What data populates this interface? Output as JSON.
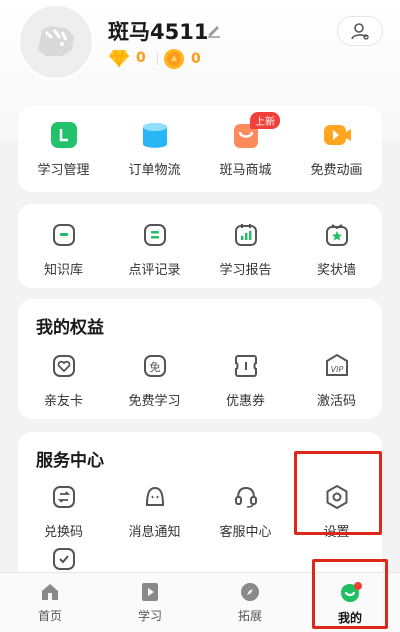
{
  "profile": {
    "username": "斑马4511",
    "gems": "0",
    "coins": "0"
  },
  "quick_actions": [
    {
      "label": "学习管理",
      "icon": "study-manage-icon"
    },
    {
      "label": "订单物流",
      "icon": "order-logistics-icon"
    },
    {
      "label": "斑马商城",
      "icon": "mall-icon",
      "badge": "上新"
    },
    {
      "label": "免费动画",
      "icon": "free-animation-icon"
    }
  ],
  "tools": [
    {
      "label": "知识库",
      "icon": "knowledge-base-icon"
    },
    {
      "label": "点评记录",
      "icon": "review-record-icon"
    },
    {
      "label": "学习报告",
      "icon": "study-report-icon"
    },
    {
      "label": "奖状墙",
      "icon": "award-wall-icon"
    }
  ],
  "benefits": {
    "title": "我的权益",
    "items": [
      {
        "label": "亲友卡",
        "icon": "family-card-icon"
      },
      {
        "label": "免费学习",
        "icon": "free-study-icon",
        "glyph": "免"
      },
      {
        "label": "优惠券",
        "icon": "coupon-icon"
      },
      {
        "label": "激活码",
        "icon": "activation-code-icon",
        "glyph": "VIP"
      }
    ]
  },
  "services": {
    "title": "服务中心",
    "items": [
      {
        "label": "兑换码",
        "icon": "redeem-code-icon"
      },
      {
        "label": "消息通知",
        "icon": "notification-icon"
      },
      {
        "label": "客服中心",
        "icon": "customer-service-icon"
      },
      {
        "label": "设置",
        "icon": "settings-icon"
      }
    ]
  },
  "bottom_nav": [
    {
      "label": "首页",
      "icon": "home-icon"
    },
    {
      "label": "学习",
      "icon": "study-icon"
    },
    {
      "label": "拓展",
      "icon": "explore-icon"
    },
    {
      "label": "我的",
      "icon": "mine-icon",
      "active": true
    }
  ],
  "colors": {
    "accent_green": "#1fbf63",
    "highlight_red": "#e0251b",
    "coin_orange": "#ff9a1a"
  }
}
